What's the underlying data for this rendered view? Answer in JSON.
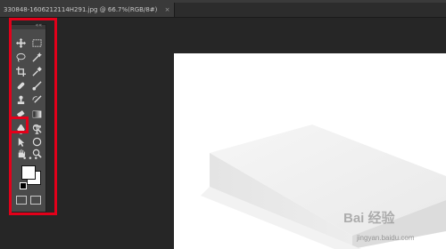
{
  "document_tab": {
    "title": "330848-1606212114H291.jpg @ 66.7%(RGB/8#)",
    "close_glyph": "×"
  },
  "toolbar": {
    "collapse_glyph": "««",
    "tools": [
      {
        "name": "move-tool",
        "icon": "move-icon"
      },
      {
        "name": "marquee-tool",
        "icon": "marquee-icon"
      },
      {
        "name": "lasso-tool",
        "icon": "lasso-icon"
      },
      {
        "name": "magic-wand-tool",
        "icon": "magic-wand-icon"
      },
      {
        "name": "crop-tool",
        "icon": "crop-icon"
      },
      {
        "name": "eyedropper-tool",
        "icon": "eyedropper-icon"
      },
      {
        "name": "healing-brush-tool",
        "icon": "bandage-icon"
      },
      {
        "name": "brush-tool",
        "icon": "brush-icon"
      },
      {
        "name": "clone-stamp-tool",
        "icon": "stamp-icon"
      },
      {
        "name": "history-brush-tool",
        "icon": "history-brush-icon"
      },
      {
        "name": "eraser-tool",
        "icon": "eraser-icon"
      },
      {
        "name": "gradient-tool",
        "icon": "gradient-icon"
      },
      {
        "name": "blur-tool",
        "icon": "blur-icon"
      },
      {
        "name": "dodge-tool",
        "icon": "dodge-icon"
      },
      {
        "name": "pen-tool",
        "icon": "pen-icon",
        "highlighted": true
      },
      {
        "name": "type-tool",
        "icon": "type-icon"
      },
      {
        "name": "path-selection-tool",
        "icon": "path-selection-icon"
      },
      {
        "name": "shape-tool",
        "icon": "shape-icon"
      },
      {
        "name": "hand-tool",
        "icon": "hand-icon"
      },
      {
        "name": "zoom-tool",
        "icon": "zoom-icon"
      }
    ],
    "more_glyph": "•••"
  },
  "colors": {
    "highlight": "#e2001a",
    "canvas": "#ffffff",
    "workspace": "#262626"
  },
  "watermark": {
    "logo": "Bai 经验",
    "url": "jingyan.baidu.com"
  }
}
